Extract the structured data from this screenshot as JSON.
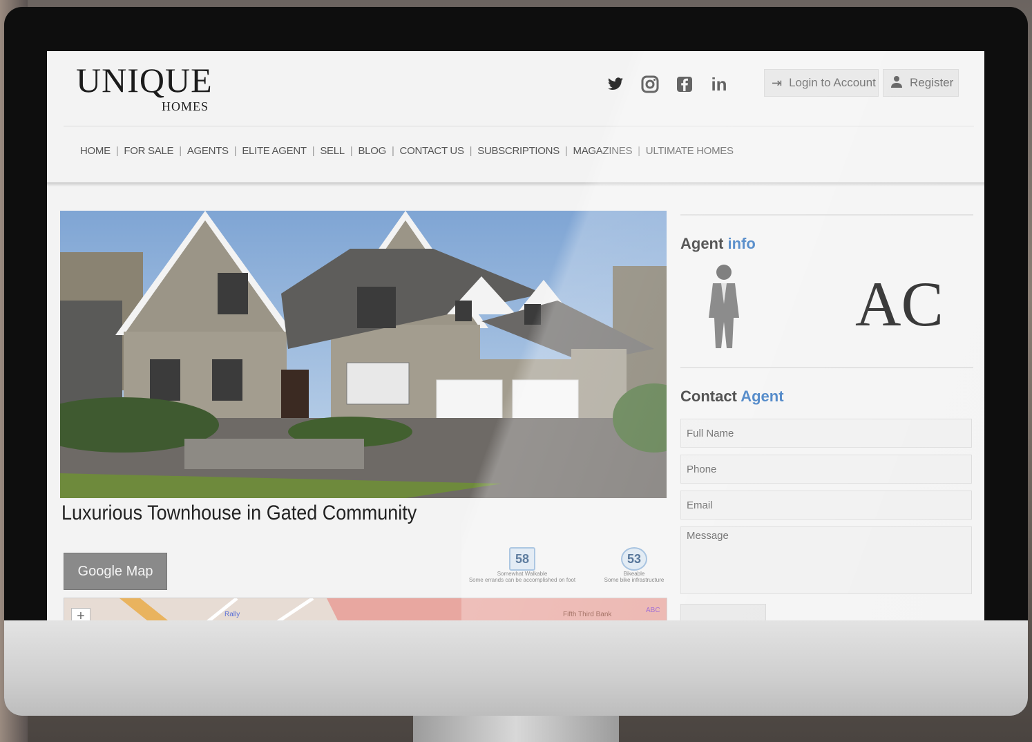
{
  "header": {
    "logo_main": "UNIQUE",
    "logo_sub": "HOMES",
    "social": [
      "twitter-icon",
      "instagram-icon",
      "facebook-icon",
      "linkedin-icon"
    ],
    "login_label": "Login to Account",
    "register_label": "Register"
  },
  "nav": {
    "items": [
      "HOME",
      "FOR SALE",
      "AGENTS",
      "ELITE AGENT",
      "SELL",
      "BLOG",
      "CONTACT US",
      "SUBSCRIPTIONS",
      "MAGAZINES",
      "ULTIMATE HOMES"
    ],
    "separator": "|"
  },
  "listing": {
    "title": "Luxurious Townhouse in Gated Community",
    "map_button": "Google Map",
    "walk_score": {
      "value": "58",
      "label": "Somewhat Walkable",
      "desc": "Some errands can be accomplished on foot"
    },
    "bike_score": {
      "value": "53",
      "label": "Bikeable",
      "desc": "Some bike infrastructure"
    },
    "map_labels": [
      "Rally",
      "Fifth Third Bank",
      "ABC"
    ],
    "map_zoom": "+"
  },
  "sidebar": {
    "agent_info_title": "Agent",
    "agent_info_accent": "info",
    "brokerage_logo": "AC",
    "contact_title": "Contact",
    "contact_accent": "Agent",
    "form": {
      "full_name": "Full Name",
      "phone": "Phone",
      "email": "Email",
      "message": "Message"
    }
  },
  "colors": {
    "accent": "#2b6fbd",
    "background": "#f3f3f3",
    "button_gray": "#8a8a8a"
  }
}
